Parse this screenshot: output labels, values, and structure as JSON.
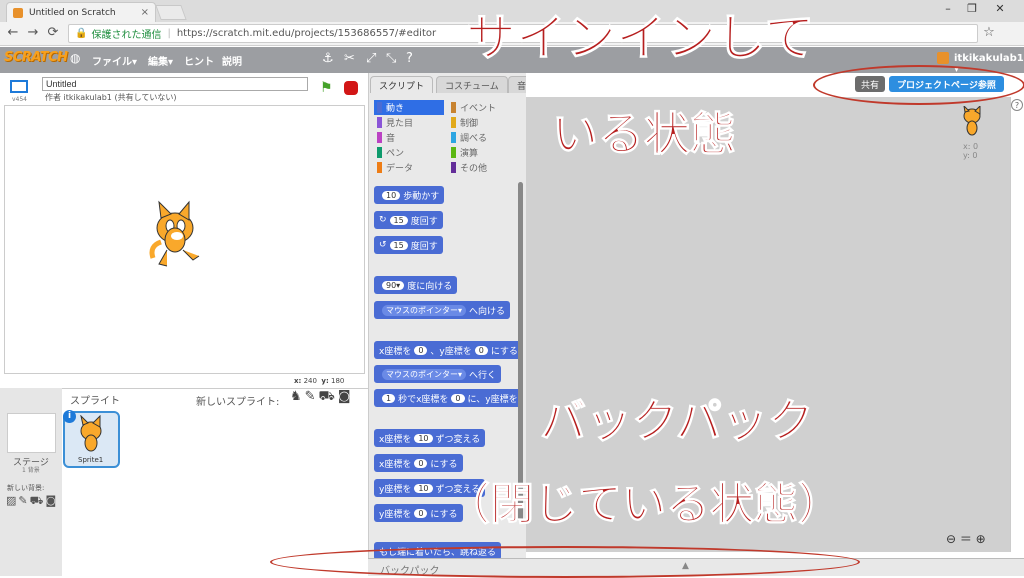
{
  "browser": {
    "tab_title": "Untitled on Scratch",
    "tab_close": "×",
    "window_min": "–",
    "window_restore": "❐",
    "window_close": "✕",
    "secure_label": "保護された通信",
    "url": "https://scratch.mit.edu/projects/153686557/#editor"
  },
  "menubar": {
    "logo": "SCRATCH",
    "file": "ファイル▾",
    "edit": "編集▾",
    "hint": "ヒント",
    "about": "説明",
    "user": "itkikakulab1 ▾"
  },
  "stage": {
    "title_value": "Untitled",
    "author": "作者 itkikakulab1 (共有していない)",
    "version": "v454",
    "x_label": "x:",
    "x_value": "240",
    "y_label": "y:",
    "y_value": "180"
  },
  "sprites": {
    "header": "スプライト",
    "new_sprite": "新しいスプライト:",
    "stage_label": "ステージ",
    "stage_count": "1 背景",
    "new_backdrop": "新しい背景:",
    "sprite1": "Sprite1"
  },
  "palette": {
    "tabs": [
      "スクリプト",
      "コスチューム",
      "音"
    ],
    "categories_left": [
      {
        "label": "動き",
        "color": "#4a6cd4"
      },
      {
        "label": "見た目",
        "color": "#8a55d7"
      },
      {
        "label": "音",
        "color": "#bb42c3"
      },
      {
        "label": "ペン",
        "color": "#0e9a6c"
      },
      {
        "label": "データ",
        "color": "#ee7d16"
      }
    ],
    "categories_right": [
      {
        "label": "イベント",
        "color": "#c88330"
      },
      {
        "label": "制御",
        "color": "#e1a91a"
      },
      {
        "label": "調べる",
        "color": "#2ca5e2"
      },
      {
        "label": "演算",
        "color": "#5cb712"
      },
      {
        "label": "その他",
        "color": "#632d99"
      }
    ],
    "blocks": {
      "move_num": "10",
      "move": "歩動かす",
      "turn_r_num": "15",
      "turn_r": "度回す",
      "turn_l_num": "15",
      "turn_l": "度回す",
      "point_num": "90▾",
      "point": "度に向ける",
      "point_to_target": "マウスのポインター▾",
      "point_to": "へ向ける",
      "goto_x": "x座標を",
      "goto_xnum": "0",
      "goto_y": "、y座標を",
      "goto_ynum": "0",
      "goto_end": "にする",
      "goto_target": "マウスのポインター▾",
      "goto_to": "へ行く",
      "glide_num": "1",
      "glide": "秒でx座標を",
      "glide_xnum": "0",
      "glide_y": "に、y座標を",
      "chx": "x座標を",
      "chx_num": "10",
      "chx_end": "ずつ変える",
      "setx": "x座標を",
      "setx_num": "0",
      "setx_end": "にする",
      "chy": "y座標を",
      "chy_num": "10",
      "chy_end": "ずつ変える",
      "sety": "y座標を",
      "sety_num": "0",
      "sety_end": "にする",
      "bounce": "もし端に着いたら、跳ね返る"
    }
  },
  "scripts": {
    "share": "共有",
    "project_page": "プロジェクトページ参照",
    "x_readout": "x: 0",
    "y_readout": "y: 0",
    "zoom": "⊖ ＝ ⊕",
    "help": "?",
    "backpack": "バックパック",
    "backpack_arrow": "▲"
  },
  "annotations": {
    "line1": "サインインして",
    "line2": "いる状態",
    "line3": "バックパック",
    "line4": "（閉じている状態）"
  }
}
